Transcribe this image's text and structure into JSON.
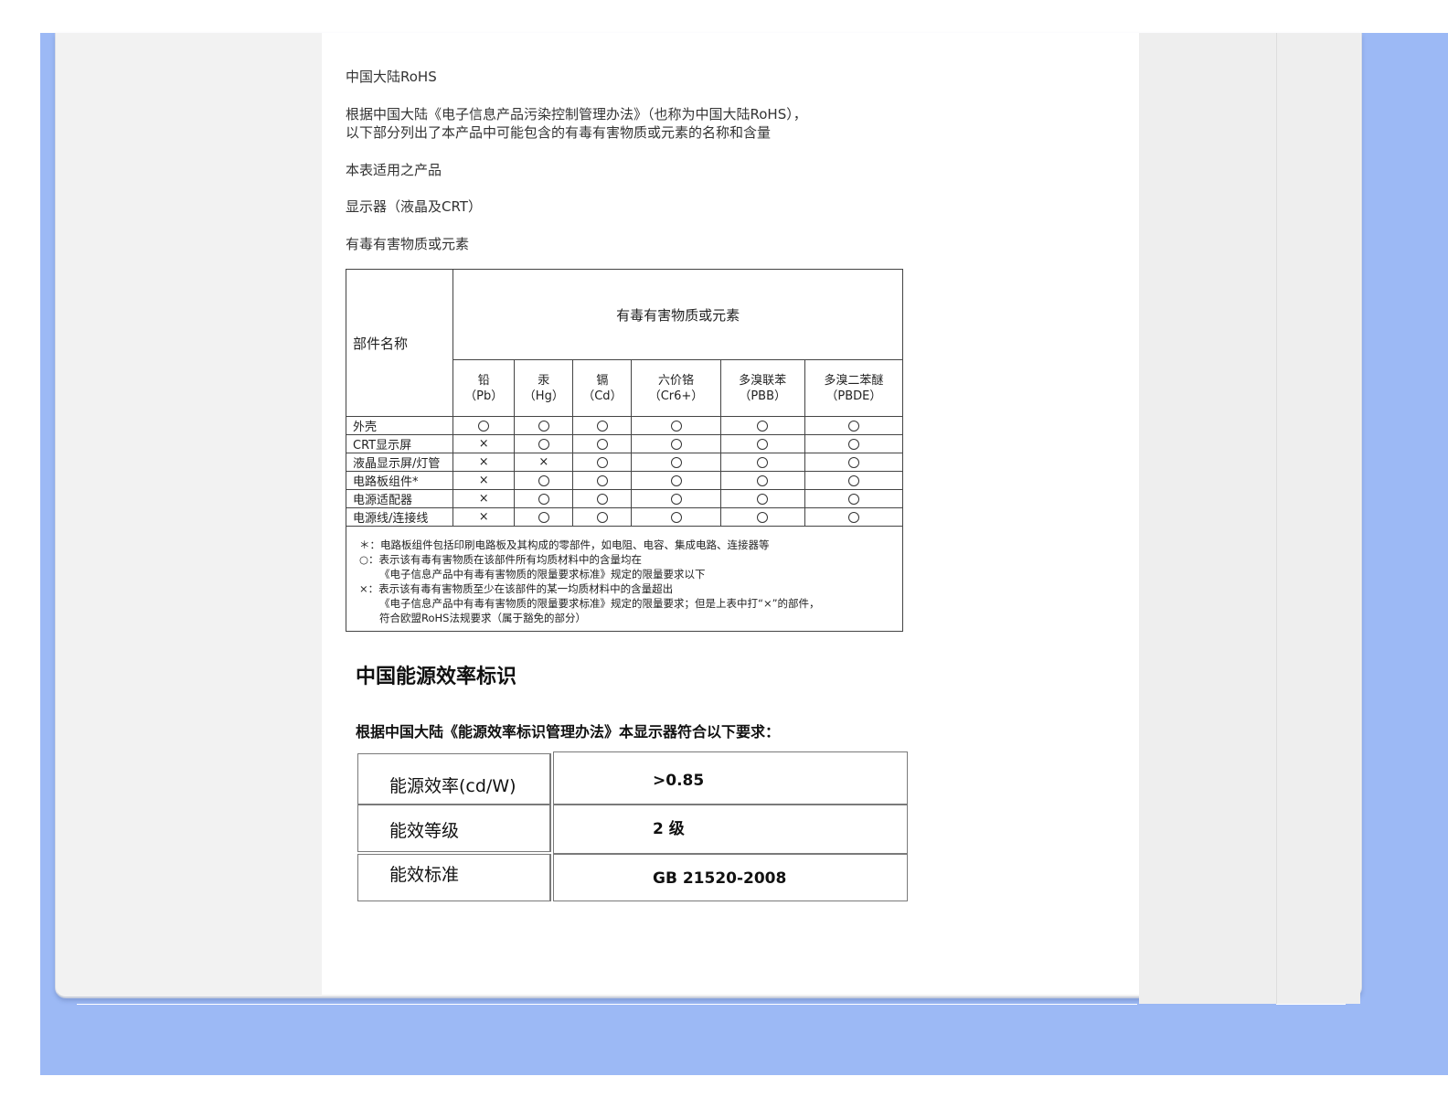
{
  "intro": {
    "heading": "中国大陆RoHS",
    "line1": "根据中国大陆《电子信息产品污染控制管理办法》（也称为中国大陆RoHS），",
    "line2": "以下部分列出了本产品中可能包含的有毒有害物质或元素的名称和含量",
    "applies_label": "本表适用之产品",
    "product": "显示器（液晶及CRT）",
    "substances_label": "有毒有害物质或元素"
  },
  "rohs_table": {
    "part_header": "部件名称",
    "group_header": "有毒有害物质或元素",
    "columns": [
      {
        "name": "铅",
        "symbol": "（Pb）"
      },
      {
        "name": "汞",
        "symbol": "（Hg）"
      },
      {
        "name": "镉",
        "symbol": "（Cd）"
      },
      {
        "name": "六价铬",
        "symbol": "（Cr6+）"
      },
      {
        "name": "多溴联苯",
        "symbol": "（PBB）"
      },
      {
        "name": "多溴二苯醚",
        "symbol": "（PBDE）"
      }
    ],
    "rows": [
      {
        "part": "外壳",
        "marks": [
          "O",
          "O",
          "O",
          "O",
          "O",
          "O"
        ]
      },
      {
        "part": "CRT显示屏",
        "marks": [
          "X",
          "O",
          "O",
          "O",
          "O",
          "O"
        ]
      },
      {
        "part": "液晶显示屏/灯管",
        "marks": [
          "X",
          "X",
          "O",
          "O",
          "O",
          "O"
        ]
      },
      {
        "part": "电路板组件*",
        "marks": [
          "X",
          "O",
          "O",
          "O",
          "O",
          "O"
        ]
      },
      {
        "part": "电源适配器",
        "marks": [
          "X",
          "O",
          "O",
          "O",
          "O",
          "O"
        ]
      },
      {
        "part": "电源线/连接线",
        "marks": [
          "X",
          "O",
          "O",
          "O",
          "O",
          "O"
        ]
      }
    ],
    "notes": [
      "＊：电路板组件包括印刷电路板及其构成的零部件，如电阻、电容、集成电路、连接器等",
      "○：表示该有毒有害物质在该部件所有均质材料中的含量均在",
      "《电子信息产品中有毒有害物质的限量要求标准》规定的限量要求以下",
      "×：表示该有毒有害物质至少在该部件的某一均质材料中的含量超出",
      "《电子信息产品中有毒有害物质的限量要求标准》规定的限量要求；但是上表中打“×”的部件，",
      "符合欧盟RoHS法规要求（属于豁免的部分）"
    ]
  },
  "energy": {
    "title": "中国能源效率标识",
    "subtitle": "根据中国大陆《能源效率标识管理办法》本显示器符合以下要求：",
    "rows": [
      {
        "label": "能源效率(cd/W)",
        "value": ">0.85"
      },
      {
        "label": "能效等级",
        "value": "2 级"
      },
      {
        "label": "能效标准",
        "value": "GB 21520-2008"
      }
    ]
  }
}
